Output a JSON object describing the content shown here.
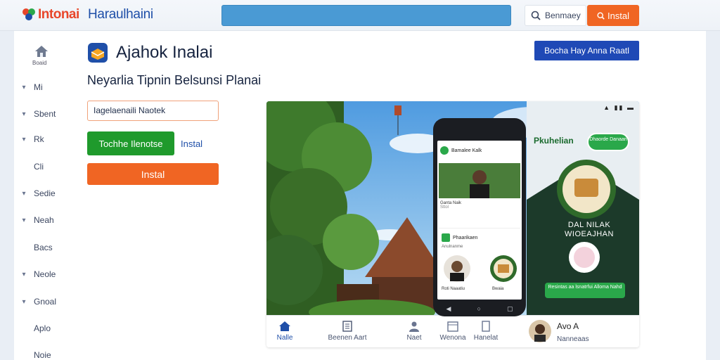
{
  "header": {
    "logo_text": "Intonai",
    "brand_text": "Haraulhaini",
    "search_button_label": "Benmaey",
    "install_label": "Instal"
  },
  "nav": {
    "home_label": "Boaid",
    "items": [
      "Mi",
      "Sbent",
      "Rk",
      "Cli",
      "Sedie",
      "Neah",
      "Bacs",
      "Neole",
      "Gnoal",
      "Aplo",
      "Noie"
    ]
  },
  "main": {
    "app_title": "Ajahok Inalai",
    "subtitle": "Neyarlia Tipnin Belsunsi Planai",
    "cta_blue": "Bocha Hay Anna Raatl",
    "input_value": "Iagelaenaili Naotek",
    "green_button": "Tochhe Ilenotse",
    "link_install": "Instal",
    "orange_button": "Instal"
  },
  "hero": {
    "phone": {
      "row1_text": "Bamalee Kalk",
      "caption1": "Ganta Naik",
      "caption1b": "Sttol",
      "card2_title": "Phaarikaen",
      "card2_sub": "Anulnanme",
      "caption_left": "Roti Naaatiu",
      "caption_right": "Bwaia"
    },
    "poster": {
      "title": "Pkuhelian",
      "pill": "Dhaorde Danaan",
      "big_text": "DAL NILAK WIOEAJHAN",
      "bar_text": "Resintas aa lsnatrfui Alloma Nahd"
    },
    "tabs": [
      "Nalle",
      "Beenen Aart",
      "Naet",
      "Wenona",
      "Hanelat"
    ],
    "author": {
      "name": "Avo A",
      "sub": "Nanneaas"
    }
  },
  "colors": {
    "accent_orange": "#f06523",
    "accent_blue": "#1f49b6",
    "accent_green": "#1f9a2c",
    "search_blue": "#4a9ad4"
  }
}
